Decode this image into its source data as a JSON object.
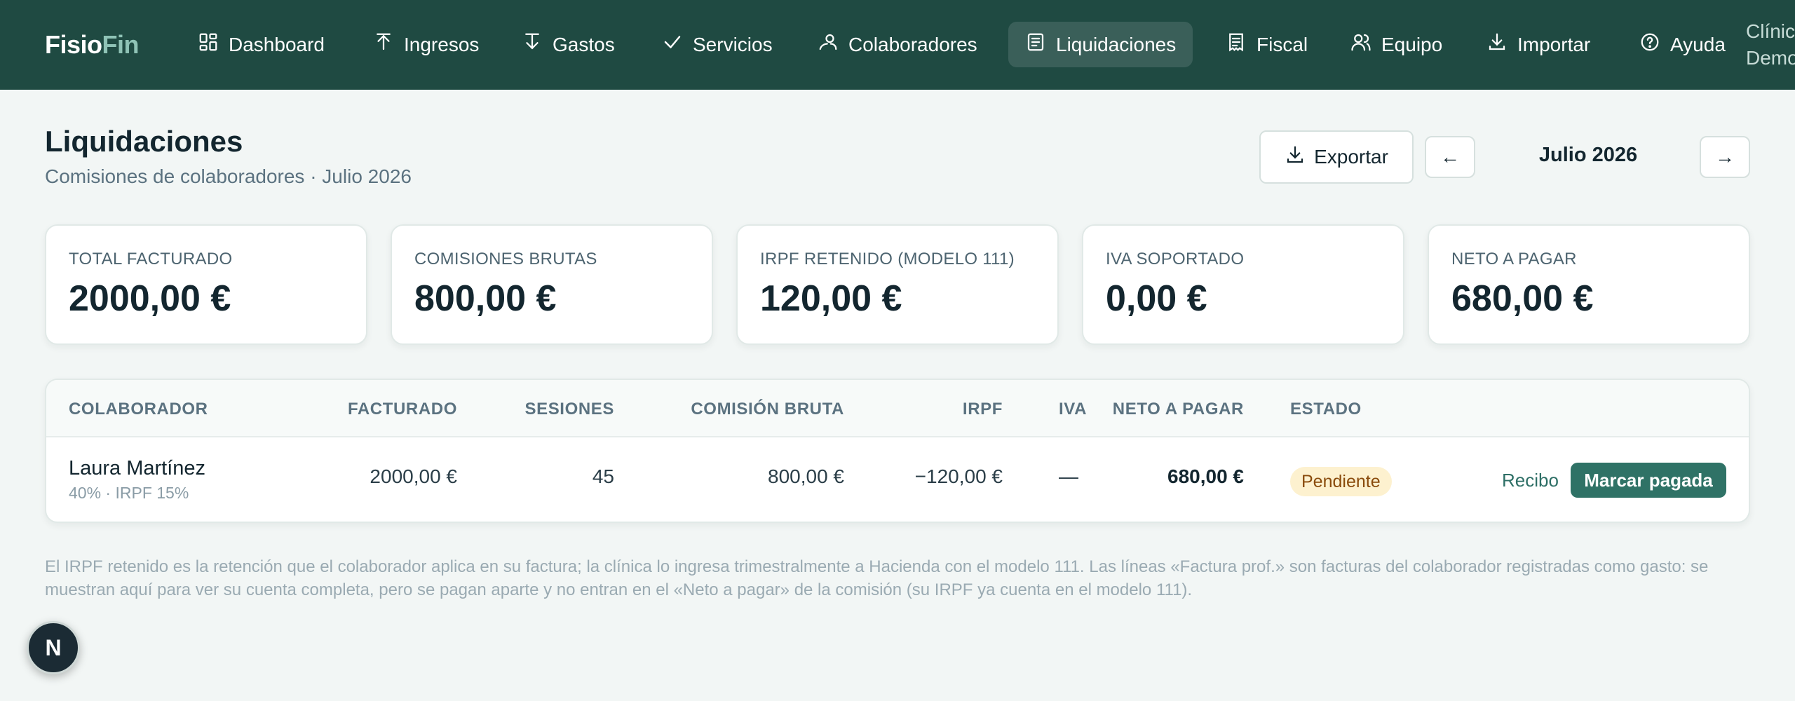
{
  "brand": {
    "part1": "Fisio",
    "part2": "Fin"
  },
  "nav": {
    "items": [
      {
        "label": "Dashboard",
        "icon": "dashboard-icon"
      },
      {
        "label": "Ingresos",
        "icon": "upload-arrow-icon"
      },
      {
        "label": "Gastos",
        "icon": "download-arrow-icon"
      },
      {
        "label": "Servicios",
        "icon": "check-icon"
      },
      {
        "label": "Colaboradores",
        "icon": "user-icon"
      },
      {
        "label": "Liquidaciones",
        "icon": "document-icon",
        "active": true
      },
      {
        "label": "Fiscal",
        "icon": "receipt-icon"
      },
      {
        "label": "Equipo",
        "icon": "users-icon"
      },
      {
        "label": "Importar",
        "icon": "import-icon"
      },
      {
        "label": "Ayuda",
        "icon": "help-icon"
      }
    ],
    "clinic_line1": "Clínic",
    "clinic_line2": "Demo"
  },
  "header": {
    "title": "Liquidaciones",
    "subtitle": "Comisiones de colaboradores · Julio 2026",
    "export_label": "Exportar",
    "prev_label": "←",
    "next_label": "→",
    "month": "Julio 2026"
  },
  "summary": [
    {
      "label": "TOTAL FACTURADO",
      "value": "2000,00 €"
    },
    {
      "label": "COMISIONES BRUTAS",
      "value": "800,00 €"
    },
    {
      "label": "IRPF RETENIDO (MODELO 111)",
      "value": "120,00 €"
    },
    {
      "label": "IVA SOPORTADO",
      "value": "0,00 €"
    },
    {
      "label": "NETO A PAGAR",
      "value": "680,00 €"
    }
  ],
  "table": {
    "columns": [
      "COLABORADOR",
      "FACTURADO",
      "SESIONES",
      "COMISIÓN BRUTA",
      "IRPF",
      "IVA",
      "NETO A PAGAR",
      "ESTADO"
    ],
    "rows": [
      {
        "name": "Laura Martínez",
        "meta": "40% · IRPF 15%",
        "facturado": "2000,00 €",
        "sesiones": "45",
        "comision": "800,00 €",
        "irpf": "−120,00 €",
        "iva": "—",
        "neto": "680,00 €",
        "estado": "Pendiente",
        "recibo_label": "Recibo",
        "pay_label": "Marcar pagada"
      }
    ]
  },
  "footnote": "El IRPF retenido es la retención que el colaborador aplica en su factura; la clínica lo ingresa trimestralmente a Hacienda con el modelo 111. Las líneas «Factura prof.» son facturas del colaborador registradas como gasto: se muestran aquí para ver su cuenta completa, pero se pagan aparte y no entran en el «Neto a pagar» de la comisión (su IRPF ya cuenta en el modelo 111).",
  "fab_label": "N",
  "colors": {
    "topbar": "#1f4a42",
    "nav_active": "#3a5f59",
    "accent": "#2f7266",
    "badge_bg": "#fdf1cf",
    "badge_text": "#8a4b0c"
  }
}
